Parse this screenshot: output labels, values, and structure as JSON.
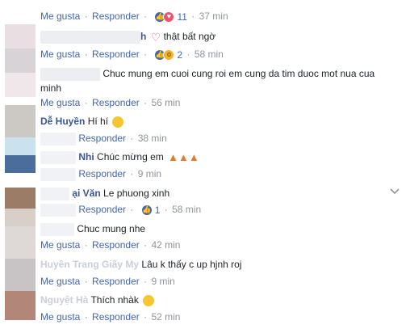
{
  "labels": {
    "like": "Me gusta",
    "reply": "Responder",
    "sep": "·"
  },
  "rows": [
    {
      "time": "37 min",
      "reactions": [
        "like",
        "love"
      ],
      "count": "11"
    },
    {
      "name": "h",
      "text": "thật bất ngờ",
      "emoji": "heart-emoji"
    },
    {
      "time": "58 min",
      "reactions": [
        "like",
        "wow"
      ],
      "count": "2"
    },
    {
      "text": "Chuc mung em cuoi cung roi em cung da tim duoc mot nua cua",
      "text2": "minh"
    },
    {
      "time": "56 min"
    },
    {
      "name": "Dễ Huyền",
      "text": "Hí hí",
      "emoji": "grin-emoji"
    },
    {
      "time": "38 min"
    },
    {
      "name": "Nhi",
      "text": "Chúc mừng em",
      "emoji": "party-popper-emoji"
    },
    {
      "time": "9 min"
    },
    {
      "name": "ại Văn",
      "text": "Le phuong xinh"
    },
    {
      "time": "58 min",
      "reactions": [
        "like"
      ],
      "count": "1"
    },
    {
      "text": "Chuc mung nhe"
    },
    {
      "time": "42 min"
    },
    {
      "name": "Huyền Trang Giấy My",
      "text": "Lâu k thấy c up hjnh roj"
    },
    {
      "time": "9 min"
    },
    {
      "name": "Nguyệt Hà",
      "text": "Thích nhàk",
      "emoji": "heart-eyes-emoji"
    },
    {
      "time": "52 min"
    }
  ],
  "colors": {
    "link": "#4267b2",
    "name": "#365899",
    "muted": "#90949c",
    "text": "#1d2129"
  }
}
